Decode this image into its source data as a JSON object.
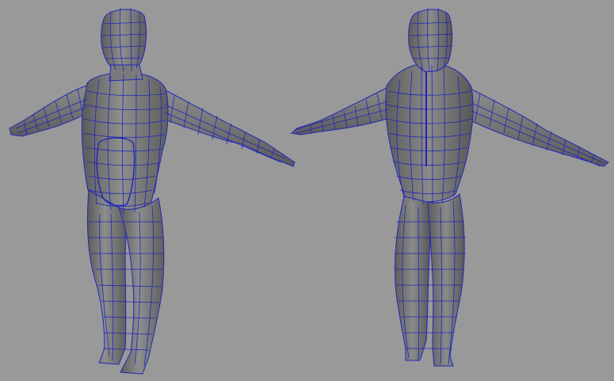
{
  "viewport": {
    "background": "#999999",
    "mesh_shade_light": "#8f8f8f",
    "mesh_shade_mid": "#6f6f6f",
    "mesh_shade_dark": "#4e4e4e",
    "wireframe_color": "#1f27b8"
  },
  "models": [
    {
      "view": "front",
      "pose": "t-pose"
    },
    {
      "view": "back",
      "pose": "t-pose"
    }
  ]
}
